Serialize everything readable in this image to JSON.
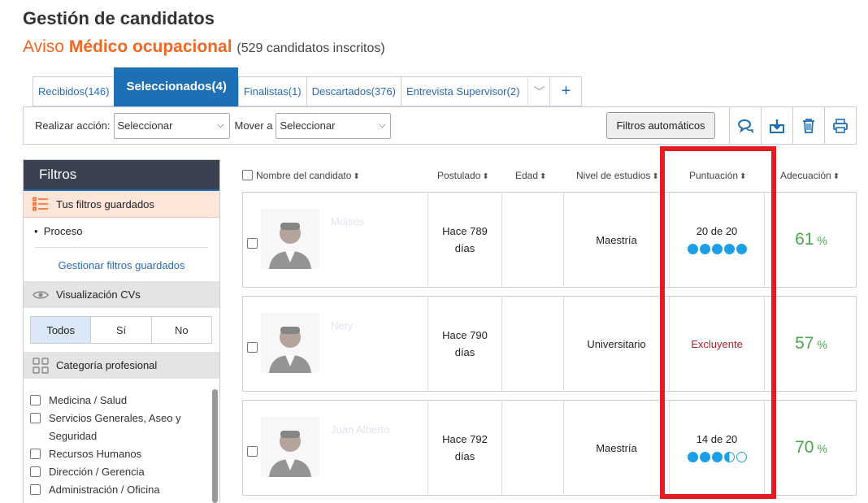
{
  "header": {
    "title": "Gestión de candidatos",
    "aviso_prefix": "Aviso",
    "aviso_name": "Médico ocupacional",
    "aviso_count": "(529 candidatos inscritos)"
  },
  "tabs": [
    {
      "label": "Recibidos(146)"
    },
    {
      "label": "Seleccionados(4)",
      "active": true
    },
    {
      "label": "Finalistas(1)"
    },
    {
      "label": "Descartados(376)"
    },
    {
      "label": "Entrevista Supervisor(2)"
    },
    {
      "label": "+"
    }
  ],
  "toolbar": {
    "action_label": "Realizar acción:",
    "action_value": "Seleccionar",
    "move_label": "Mover a",
    "move_value": "Seleccionar",
    "auto_filters": "Filtros automáticos",
    "icons": [
      "chat-icon",
      "download-icon",
      "trash-icon",
      "print-icon"
    ]
  },
  "sidebar": {
    "title": "Filtros",
    "saved_title": "Tus filtros guardados",
    "saved_item": "Proceso",
    "manage_link": "Gestionar filtros guardados",
    "cv_title": "Visualización CVs",
    "cv_options": [
      "Todos",
      "Sí",
      "No"
    ],
    "cv_selected": "Todos",
    "category_title": "Categoría profesional",
    "categories": [
      "Medicina / Salud",
      "Servicios Generales, Aseo y Seguridad",
      "Recursos Humanos",
      "Dirección / Gerencia",
      "Administración / Oficina"
    ]
  },
  "table": {
    "columns": [
      "Nombre del candidato",
      "Postulado",
      "Edad",
      "Nivel de estudios",
      "Puntuación",
      "Adecuación"
    ],
    "rows": [
      {
        "name": "Moisés",
        "posted": "Hace 789 días",
        "age": "",
        "education": "Maestría",
        "score": "20 de 20",
        "dots": [
          "full",
          "full",
          "full",
          "full",
          "full"
        ],
        "adequacy": "61",
        "pct": "%"
      },
      {
        "name": "Nery",
        "posted": "Hace 790 días",
        "age": "",
        "education": "Universitario",
        "score": "Excluyente",
        "dots": [],
        "adequacy": "57",
        "pct": "%"
      },
      {
        "name": "Juan Alberto",
        "posted": "Hace 792 días",
        "age": "",
        "education": "Maestría",
        "score": "14 de 20",
        "dots": [
          "full",
          "full",
          "full",
          "half",
          "empty"
        ],
        "adequacy": "70",
        "pct": "%"
      }
    ]
  },
  "colors": {
    "accent": "#1f6fb5",
    "orange": "#f26722",
    "highlight": "#e31b23",
    "score_blue": "#1aa0e6",
    "green": "#4aa64a"
  }
}
